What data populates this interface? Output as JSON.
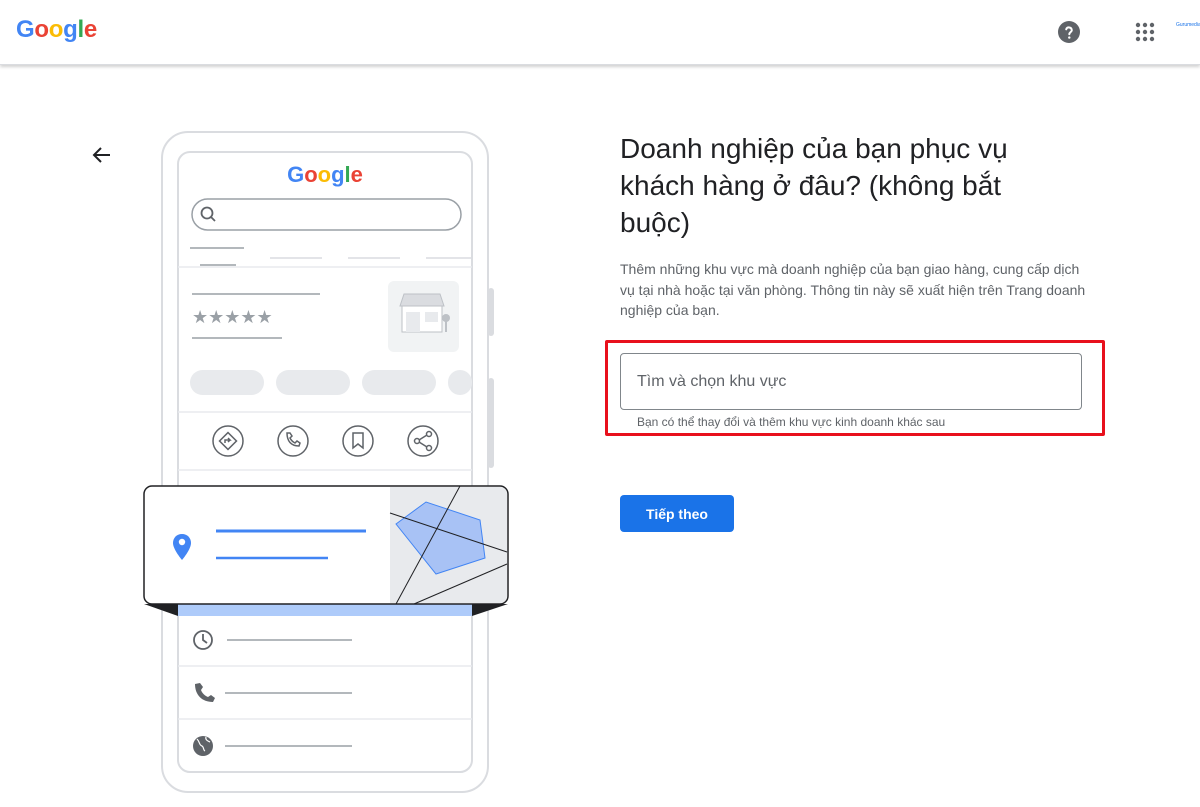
{
  "header": {
    "logo_letters": [
      {
        "ch": "G",
        "color": "#4285F4"
      },
      {
        "ch": "o",
        "color": "#EA4335"
      },
      {
        "ch": "o",
        "color": "#FBBC05"
      },
      {
        "ch": "g",
        "color": "#4285F4"
      },
      {
        "ch": "l",
        "color": "#34A853"
      },
      {
        "ch": "e",
        "color": "#EA4335"
      }
    ],
    "help_icon": "help-circle-icon",
    "apps_icon": "apps-grid-icon",
    "account_label": "Gurumedia"
  },
  "illustration": {
    "logo_text": "Google",
    "icons": [
      "search-icon",
      "storefront-icon",
      "directions-icon",
      "call-icon",
      "bookmark-icon",
      "share-icon",
      "location-pin-icon",
      "clock-icon",
      "phone-icon",
      "globe-icon"
    ],
    "stars": "★★★★★",
    "colors": {
      "accent": "#4285F4",
      "map_fill": "#a8c2f5",
      "gray": "#dadce0",
      "star": "#9aa0a6"
    }
  },
  "main": {
    "back_icon": "arrow-back-icon",
    "title": "Doanh nghiệp của bạn phục vụ khách hàng ở đâu? (không bắt buộc)",
    "description": "Thêm những khu vực mà doanh nghiệp của bạn giao hàng, cung cấp dịch vụ tại nhà hoặc tại văn phòng. Thông tin này sẽ xuất hiện trên Trang doanh nghiệp của bạn.",
    "search": {
      "placeholder": "Tìm và chọn khu vực",
      "value": "",
      "helper": "Bạn có thể thay đổi và thêm khu vực kinh doanh khác sau"
    },
    "next_label": "Tiếp theo",
    "highlight_color": "#e8101c",
    "primary_color": "#1a73e8"
  }
}
